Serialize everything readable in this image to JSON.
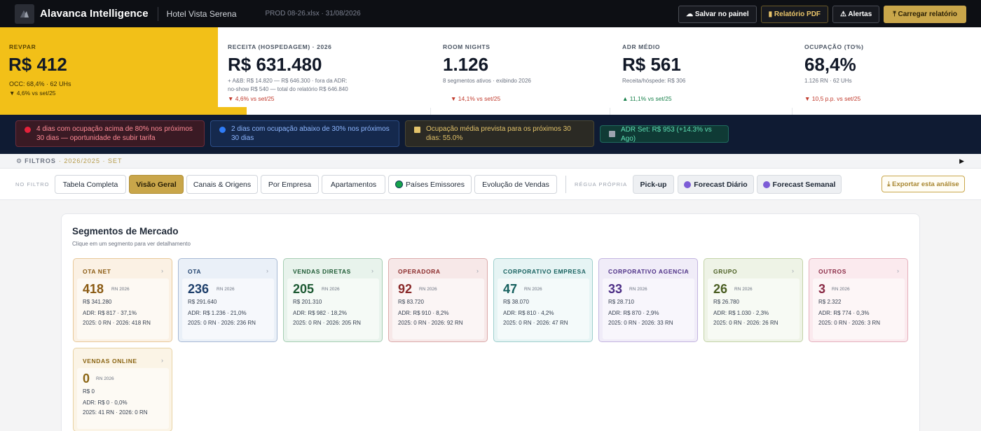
{
  "topbar": {
    "brand": "Alavanca Intelligence",
    "hotel": "Hotel Vista Serena",
    "file": "PROD 08-26.xlsx · 31/08/2026",
    "buttons": {
      "save": "☁ Salvar no painel",
      "pdf": "▮ Relatório PDF",
      "alerts": "⚠ Alertas",
      "load": "⤒  Carregar relatório"
    }
  },
  "kpis": [
    {
      "label": "REVPAR",
      "value": "R$ 412",
      "sub1": "OCC: 68,4% · 62 UHs",
      "sub2": "",
      "delta": "▼ 4,6% vs set/25",
      "trend": "down"
    },
    {
      "label": "RECEITA (HOSPEDAGEM) · 2026",
      "value": "R$ 631.480",
      "sub1": "+ A&B: R$ 14.820 — R$ 646.300 · fora da ADR:",
      "sub2": "no-show R$ 540 — total do relatório R$ 646.840",
      "delta": "▼ 4,6% vs set/25",
      "trend": "down"
    },
    {
      "label": "ROOM NIGHTS",
      "value": "1.126",
      "sub1": "8 segmentos ativos · exibindo 2026",
      "sub2": "",
      "delta": "▼ 14,1% vs set/25",
      "trend": "down"
    },
    {
      "label": "ADR MÉDIO",
      "value": "R$ 561",
      "sub1": "Receita/hóspede: R$ 306",
      "sub2": "",
      "delta": "▲ 11,1% vs set/25",
      "trend": "up"
    },
    {
      "label": "OCUPAÇÃO (TO%)",
      "value": "68,4%",
      "sub1": "1.126 RN · 62 UHs",
      "sub2": "",
      "delta": "▼ 10,5 p.p. vs set/25",
      "trend": "down"
    }
  ],
  "alerts": {
    "a1": "4 dias com ocupação acima de 80% nos próximos 30 dias — oportunidade de subir tarifa",
    "a2": "2 dias com ocupação abaixo de 30% nos próximos 30 dias",
    "a3": "Ocupação média prevista para os próximos 30 dias: 55.0%",
    "a4": "ADR Set: R$ 953 (+14.3% vs Ago)"
  },
  "filters": {
    "gear": "⚙",
    "label": "FILTROS",
    "period": "· 2026/2025 · SET",
    "toggle": "▶"
  },
  "tabs": {
    "no_filtro": "NO FILTRO",
    "items": [
      "Tabela Completa",
      "Visão Geral",
      "Canais & Origens",
      "Por Empresa",
      "Apartamentos",
      "Países Emissores",
      "Evolução de Vendas"
    ],
    "active": "Visão Geral",
    "regua": "RÉGUA PRÓPRIA",
    "own": [
      "Pick-up",
      "Forecast Diário",
      "Forecast Semanal"
    ],
    "export": "⤓ Exportar esta análise"
  },
  "panel": {
    "title": "Segmentos de Mercado",
    "subtitle": "Clique em um segmento para ver detalhamento"
  },
  "rn_label": "RN 2026",
  "chevron": "›",
  "segments": [
    {
      "name": "OTA NET",
      "rn": "418",
      "revenue": "R$ 341.280",
      "adr": "ADR: R$ 817 · 37,1%",
      "compare": "2025: 0 RN · 2026: 418 RN",
      "bg": "#fbf1e4",
      "border": "#e8c99a",
      "accent": "#8a5a12"
    },
    {
      "name": "OTA",
      "rn": "236",
      "revenue": "R$ 291.640",
      "adr": "ADR: R$ 1.236 · 21,0%",
      "compare": "2025: 0 RN · 2026: 236 RN",
      "bg": "#eaf0f8",
      "border": "#a7b9d4",
      "accent": "#1e3f6b"
    },
    {
      "name": "VENDAS DIRETAS",
      "rn": "205",
      "revenue": "R$ 201.310",
      "adr": "ADR: R$ 982 · 18,2%",
      "compare": "2025: 0 RN · 2026: 205 RN",
      "bg": "#e8f3ec",
      "border": "#a6cdb3",
      "accent": "#1d5a33"
    },
    {
      "name": "OPERADORA",
      "rn": "92",
      "revenue": "R$ 83.720",
      "adr": "ADR: R$ 910 · 8,2%",
      "compare": "2025: 0 RN · 2026: 92 RN",
      "bg": "#f7e8e8",
      "border": "#dbaaaa",
      "accent": "#8a2a2a"
    },
    {
      "name": "CORPORATIVO EMPRESA",
      "rn": "47",
      "revenue": "R$ 38.070",
      "adr": "ADR: R$ 810 · 4,2%",
      "compare": "2025: 0 RN · 2026: 47 RN",
      "bg": "#e6f4f4",
      "border": "#9fcfcd",
      "accent": "#15605e"
    },
    {
      "name": "CORPORATIVO AGENCIA",
      "rn": "33",
      "revenue": "R$ 28.710",
      "adr": "ADR: R$ 870 · 2,9%",
      "compare": "2025: 0 RN · 2026: 33 RN",
      "bg": "#f0ecf8",
      "border": "#c3b5e0",
      "accent": "#4d2f86"
    },
    {
      "name": "GRUPO",
      "rn": "26",
      "revenue": "R$ 26.780",
      "adr": "ADR: R$ 1.030 · 2,3%",
      "compare": "2025: 0 RN · 2026: 26 RN",
      "bg": "#eef3e6",
      "border": "#c3d3a8",
      "accent": "#4a5e22"
    },
    {
      "name": "OUTROS",
      "rn": "3",
      "revenue": "R$ 2.322",
      "adr": "ADR: R$ 774 · 0,3%",
      "compare": "2025: 0 RN · 2026: 3 RN",
      "bg": "#fbeaee",
      "border": "#e5b0bd",
      "accent": "#8a2a45"
    },
    {
      "name": "VENDAS ONLINE",
      "rn": "0",
      "revenue": "R$ 0",
      "adr": "ADR: R$ 0 · 0,0%",
      "compare": "2025: 41 RN · 2026: 0 RN",
      "bg": "#fbf4e6",
      "border": "#e8d2a4",
      "accent": "#8a6412"
    }
  ]
}
